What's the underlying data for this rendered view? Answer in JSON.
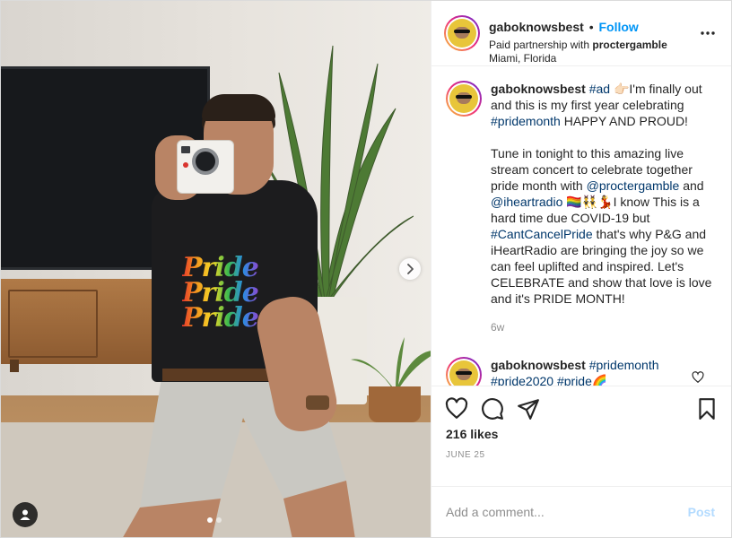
{
  "header": {
    "username": "gaboknowsbest",
    "separator": "•",
    "follow_label": "Follow",
    "partnership_prefix": "Paid partnership with",
    "partner": "proctergamble",
    "location": "Miami, Florida"
  },
  "media": {
    "shirt_text": [
      "Pride",
      "Pride",
      "Pride"
    ],
    "slide_count": 2,
    "active_slide": 1
  },
  "caption": {
    "username": "gaboknowsbest",
    "hashtag_ad": "#ad",
    "pointing_emoji": "👉🏻",
    "line1_rest": "I'm finally out and this is my first year celebrating",
    "hashtag_pride": "#pridemonth",
    "line1_end": "HAPPY AND PROUD!",
    "para2_start": "Tune in tonight to this amazing live stream concert to celebrate together pride month with",
    "mention1": "@proctergamble",
    "and": "and",
    "mention2": "@iheartradio",
    "emojis": "🏳️‍🌈👯‍♂️💃",
    "para2_mid": "I know This is a hard time due COVID-19 but",
    "hashtag_cant": "#CantCancelPride",
    "para2_end": "that's why P&G and iHeartRadio are bringing the joy so we can feel uplifted and inspired. Let's CELEBRATE and show that love is love and it's PRIDE MONTH!",
    "time": "6w"
  },
  "reply": {
    "username": "gaboknowsbest",
    "hashtag1": "#pridemonth",
    "hashtag2": "#pride2020",
    "hashtag3": "#pride",
    "emoji": "🌈"
  },
  "actions": {
    "likes": "216 likes",
    "date": "JUNE 25"
  },
  "add_comment": {
    "placeholder": "Add a comment...",
    "post_label": "Post"
  },
  "colors": {
    "link": "#0095f6",
    "tag": "#00376b",
    "muted": "#8e8e8e",
    "post_disabled": "#b3dbff"
  },
  "icons": [
    "more-icon",
    "heart-icon",
    "comment-icon",
    "share-icon",
    "bookmark-icon",
    "chevron-right-icon",
    "user-tag-icon",
    "small-heart-icon"
  ]
}
